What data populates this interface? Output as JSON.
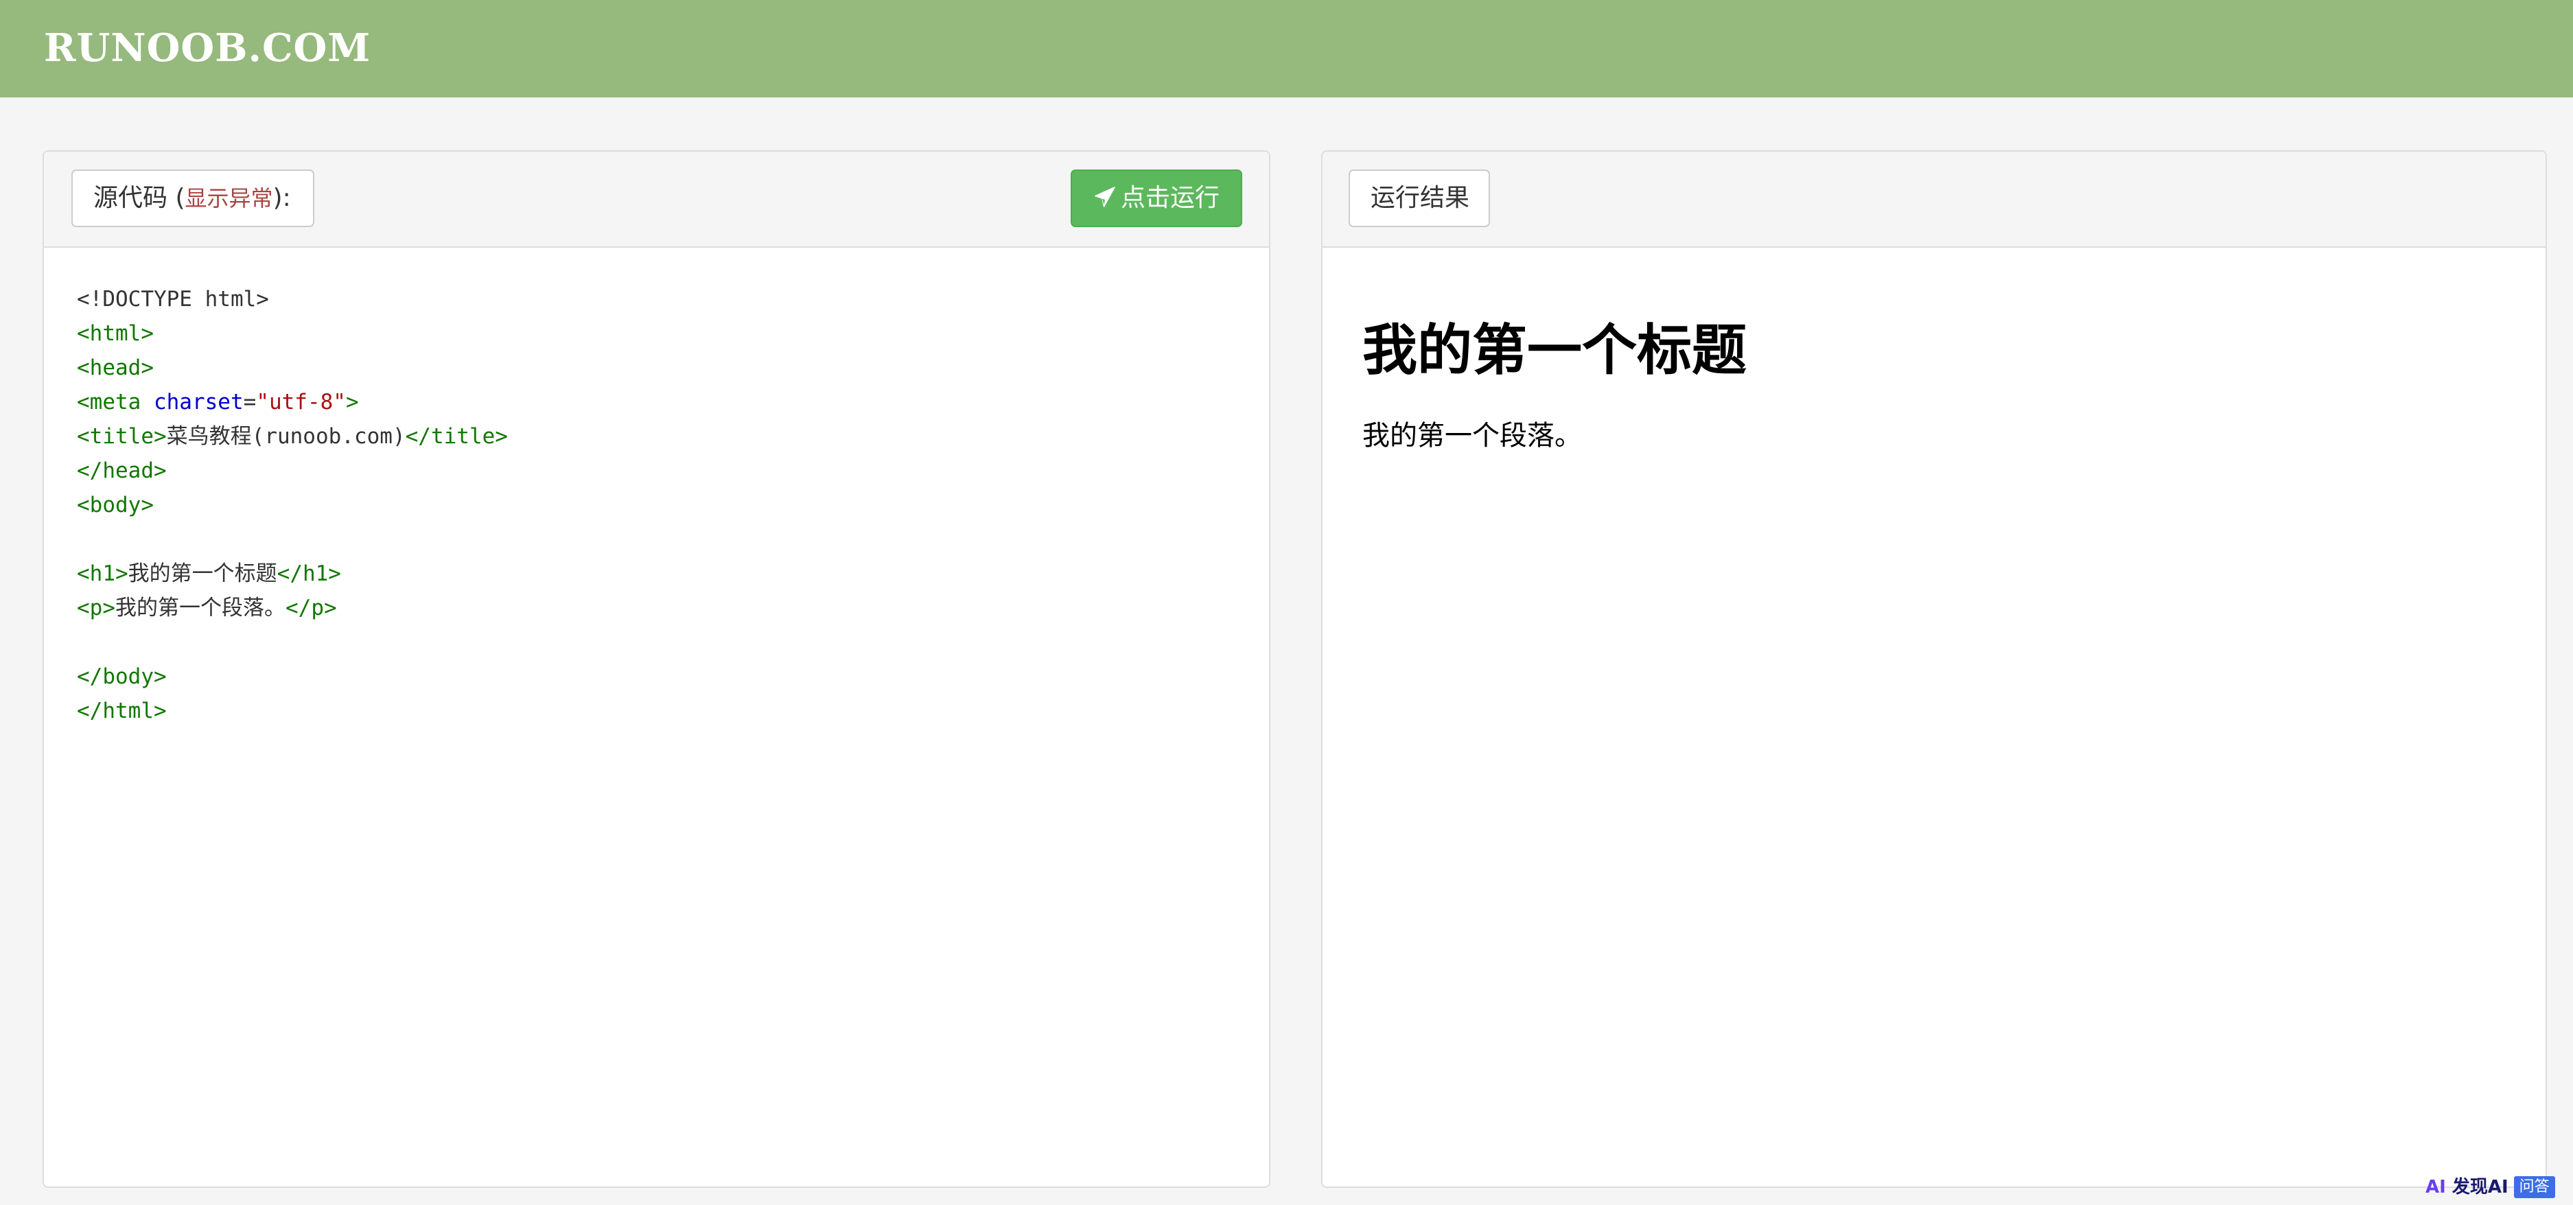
{
  "header": {
    "logo": "RUNOOB.COM",
    "background_color": "#96b97d"
  },
  "source_panel": {
    "label": "源代码",
    "error_open": " (",
    "error_text": "显示异常",
    "error_close": "):",
    "run_button": "点击运行",
    "run_button_icon": "paper-plane-icon",
    "run_button_color": "#5cb85c",
    "code_lines": [
      [
        {
          "t": "plain",
          "v": "<!DOCTYPE html>"
        }
      ],
      [
        {
          "t": "tag",
          "v": "<html>"
        }
      ],
      [
        {
          "t": "tag",
          "v": "<head>"
        }
      ],
      [
        {
          "t": "tag",
          "v": "<meta "
        },
        {
          "t": "attr",
          "v": "charset"
        },
        {
          "t": "plain",
          "v": "="
        },
        {
          "t": "str",
          "v": "\"utf-8\""
        },
        {
          "t": "tag",
          "v": ">"
        }
      ],
      [
        {
          "t": "tag",
          "v": "<title>"
        },
        {
          "t": "cjk",
          "v": "菜鸟教程"
        },
        {
          "t": "plain",
          "v": "(runoob.com)"
        },
        {
          "t": "tag",
          "v": "</title>"
        }
      ],
      [
        {
          "t": "tag",
          "v": "</head>"
        }
      ],
      [
        {
          "t": "tag",
          "v": "<body>"
        }
      ],
      [],
      [
        {
          "t": "tag",
          "v": "<h1>"
        },
        {
          "t": "cjk",
          "v": "我的第一个标题"
        },
        {
          "t": "tag",
          "v": "</h1>"
        }
      ],
      [
        {
          "t": "tag",
          "v": "<p>"
        },
        {
          "t": "cjk",
          "v": "我的第一个段落。"
        },
        {
          "t": "tag",
          "v": "</p>"
        }
      ],
      [],
      [
        {
          "t": "tag",
          "v": "</body>"
        }
      ],
      [
        {
          "t": "tag",
          "v": "</html>"
        }
      ]
    ]
  },
  "result_panel": {
    "label": "运行结果",
    "heading": "我的第一个标题",
    "paragraph": "我的第一个段落。"
  },
  "badge": {
    "logo_mark": "AI",
    "logo_text": "发现AI",
    "tag": "问答"
  }
}
